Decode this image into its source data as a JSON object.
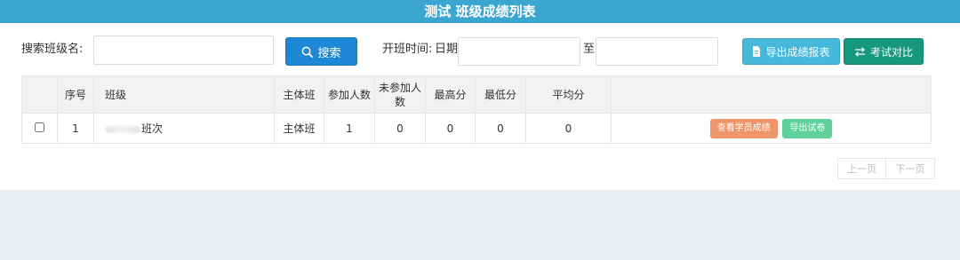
{
  "header": {
    "title": "测试 班级成绩列表"
  },
  "search": {
    "class_label": "搜索班级名:",
    "class_value": "",
    "search_button": "搜索",
    "open_time_label": "开班时间:",
    "date_label": "日期",
    "date_from": "",
    "to_label": "至",
    "date_to": ""
  },
  "actions": {
    "export_report": "导出成绩报表",
    "exam_compare": "考试对比"
  },
  "table": {
    "columns": [
      "序号",
      "班级",
      "主体班",
      "参加人数",
      "未参加人数",
      "最高分",
      "最低分",
      "平均分",
      ""
    ],
    "rows": [
      {
        "index": "1",
        "class_suffix": "班次",
        "type": "主体班",
        "attended": "1",
        "absent": "0",
        "max": "0",
        "min": "0",
        "avg": "0",
        "view_button": "查看学员成绩",
        "export_button": "导出试卷"
      }
    ]
  },
  "pagination": {
    "prev": "上一页",
    "next": "下一页"
  },
  "icons": {
    "search": "search-icon",
    "export": "document-icon",
    "compare": "swap-arrows-icon"
  },
  "colors": {
    "titlebar": "#3ba7d0",
    "search_button": "#1e88d7",
    "export_button": "#46b8da",
    "compare_button": "#16987e",
    "view_button": "#ef956a",
    "export_paper_button": "#5fd19a"
  }
}
